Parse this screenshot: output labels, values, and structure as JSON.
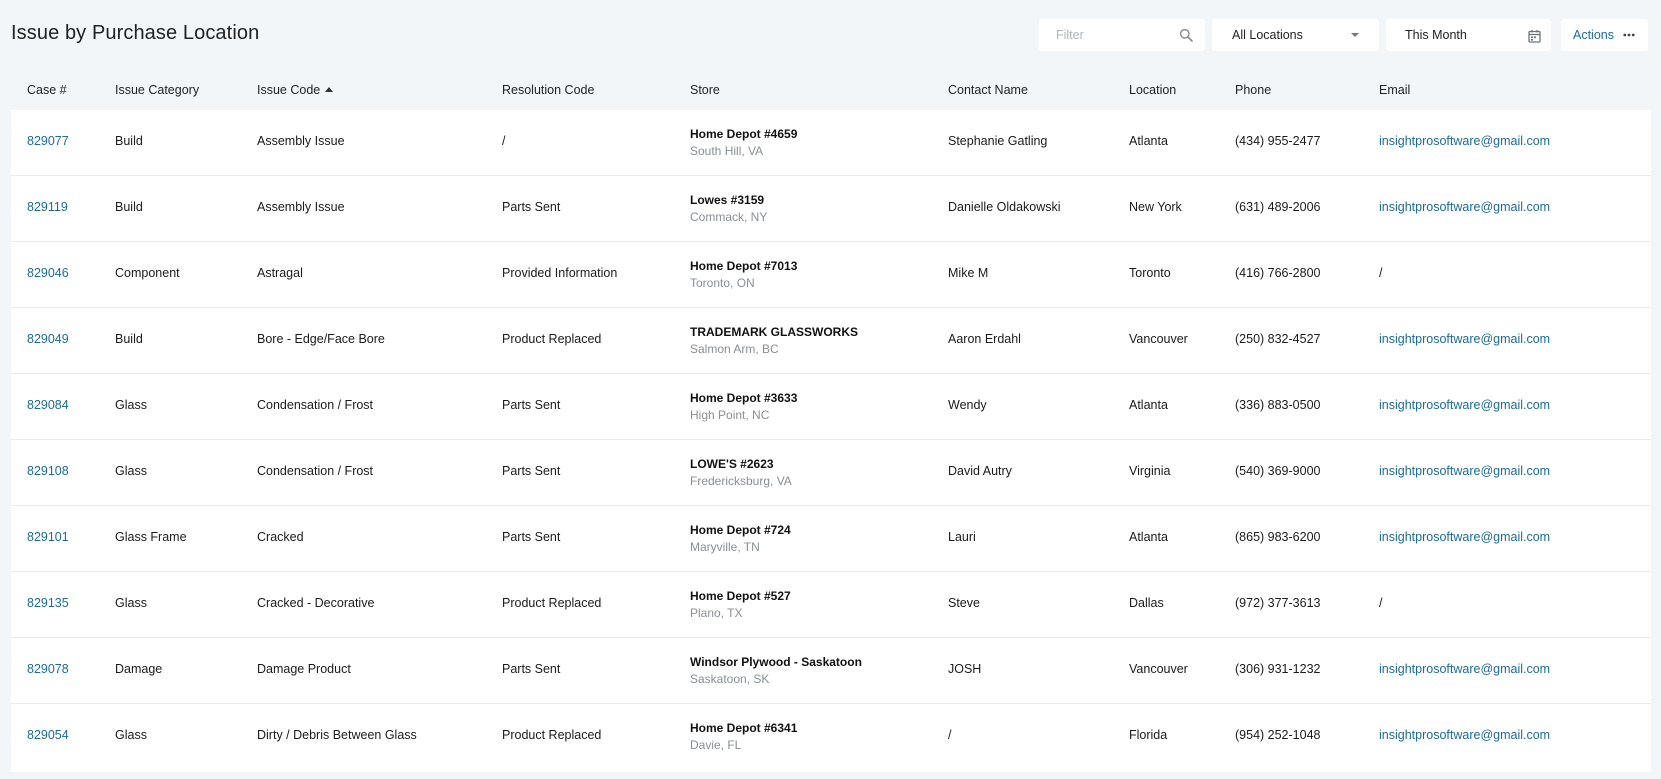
{
  "page": {
    "title": "Issue by Purchase Location"
  },
  "toolbar": {
    "filter_placeholder": "Filter",
    "location_value": "All Locations",
    "date_value": "This Month",
    "actions_label": "Actions"
  },
  "colors": {
    "background": "#f2f6f9",
    "link": "#1c6b99",
    "muted": "#8a8f94"
  },
  "icons": {
    "filter": "search-icon",
    "location": "caret-down-icon",
    "date": "calendar-icon",
    "actions": "more-horizontal-icon",
    "sort": "sort-ascending-icon"
  },
  "table": {
    "columns": [
      "Case #",
      "Issue Category",
      "Issue Code",
      "Resolution Code",
      "Store",
      "Contact Name",
      "Location",
      "Phone",
      "Email"
    ],
    "sorted_column": "Issue Code",
    "rows": [
      {
        "case": "829077",
        "category": "Build",
        "code": "Assembly Issue",
        "resolution": "/",
        "store_name": "Home Depot #4659",
        "store_addr": "South Hill, VA",
        "contact": "Stephanie Gatling",
        "location": "Atlanta",
        "phone": "(434) 955-2477",
        "email": "insightprosoftware@gmail.com"
      },
      {
        "case": "829119",
        "category": "Build",
        "code": "Assembly Issue",
        "resolution": "Parts Sent",
        "store_name": "Lowes #3159",
        "store_addr": "Commack, NY",
        "contact": "Danielle Oldakowski",
        "location": "New York",
        "phone": "(631) 489-2006",
        "email": "insightprosoftware@gmail.com"
      },
      {
        "case": "829046",
        "category": "Component",
        "code": "Astragal",
        "resolution": "Provided Information",
        "store_name": "Home Depot #7013",
        "store_addr": "Toronto, ON",
        "contact": "Mike M",
        "location": "Toronto",
        "phone": "(416) 766-2800",
        "email": "/"
      },
      {
        "case": "829049",
        "category": "Build",
        "code": "Bore - Edge/Face Bore",
        "resolution": "Product Replaced",
        "store_name": "TRADEMARK GLASSWORKS",
        "store_addr": "Salmon Arm, BC",
        "contact": "Aaron Erdahl",
        "location": "Vancouver",
        "phone": "(250) 832-4527",
        "email": "insightprosoftware@gmail.com"
      },
      {
        "case": "829084",
        "category": "Glass",
        "code": "Condensation / Frost",
        "resolution": "Parts Sent",
        "store_name": "Home Depot #3633",
        "store_addr": "High Point, NC",
        "contact": "Wendy",
        "location": "Atlanta",
        "phone": "(336) 883-0500",
        "email": "insightprosoftware@gmail.com"
      },
      {
        "case": "829108",
        "category": "Glass",
        "code": "Condensation / Frost",
        "resolution": "Parts Sent",
        "store_name": "LOWE'S #2623",
        "store_addr": "Fredericksburg, VA",
        "contact": "David Autry",
        "location": "Virginia",
        "phone": "(540) 369-9000",
        "email": "insightprosoftware@gmail.com"
      },
      {
        "case": "829101",
        "category": "Glass Frame",
        "code": "Cracked",
        "resolution": "Parts Sent",
        "store_name": "Home Depot #724",
        "store_addr": "Maryville, TN",
        "contact": "Lauri",
        "location": "Atlanta",
        "phone": "(865) 983-6200",
        "email": "insightprosoftware@gmail.com"
      },
      {
        "case": "829135",
        "category": "Glass",
        "code": "Cracked - Decorative",
        "resolution": "Product Replaced",
        "store_name": "Home Depot #527",
        "store_addr": "Plano, TX",
        "contact": "Steve",
        "location": "Dallas",
        "phone": "(972) 377-3613",
        "email": "/"
      },
      {
        "case": "829078",
        "category": "Damage",
        "code": "Damage Product",
        "resolution": "Parts Sent",
        "store_name": "Windsor Plywood - Saskatoon",
        "store_addr": "Saskatoon, SK",
        "contact": "JOSH",
        "location": "Vancouver",
        "phone": "(306) 931-1232",
        "email": "insightprosoftware@gmail.com"
      },
      {
        "case": "829054",
        "category": "Glass",
        "code": "Dirty / Debris Between Glass",
        "resolution": "Product Replaced",
        "store_name": "Home Depot #6341",
        "store_addr": "Davie, FL",
        "contact": "/",
        "location": "Florida",
        "phone": "(954) 252-1048",
        "email": "insightprosoftware@gmail.com"
      }
    ]
  }
}
